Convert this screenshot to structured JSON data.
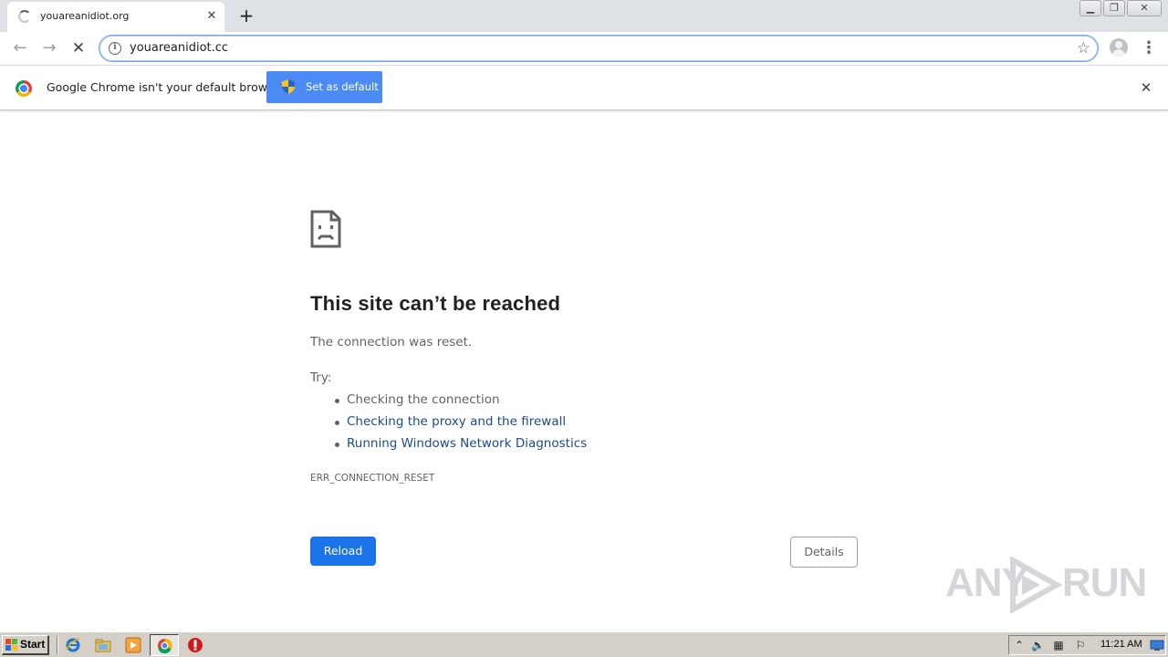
{
  "tab": {
    "title": "youareanidiot.org"
  },
  "toolbar": {
    "url": "youareanidiot.cc"
  },
  "infobar": {
    "message": "Google Chrome isn't your default browser",
    "button_label": "Set as default"
  },
  "error": {
    "title": "This site can’t be reached",
    "subtitle": "The connection was reset.",
    "try_label": "Try:",
    "suggestions": [
      "Checking the connection",
      "Checking the proxy and the firewall",
      "Running Windows Network Diagnostics"
    ],
    "code": "ERR_CONNECTION_RESET",
    "reload_label": "Reload",
    "details_label": "Details"
  },
  "watermark": {
    "left": "ANY",
    "right": "RUN"
  },
  "taskbar": {
    "start_label": "Start",
    "clock": "11:21 AM"
  },
  "colors": {
    "accent": "#1a73e8",
    "infobar_button": "#4c8bf5",
    "link": "#1a4a8f"
  }
}
